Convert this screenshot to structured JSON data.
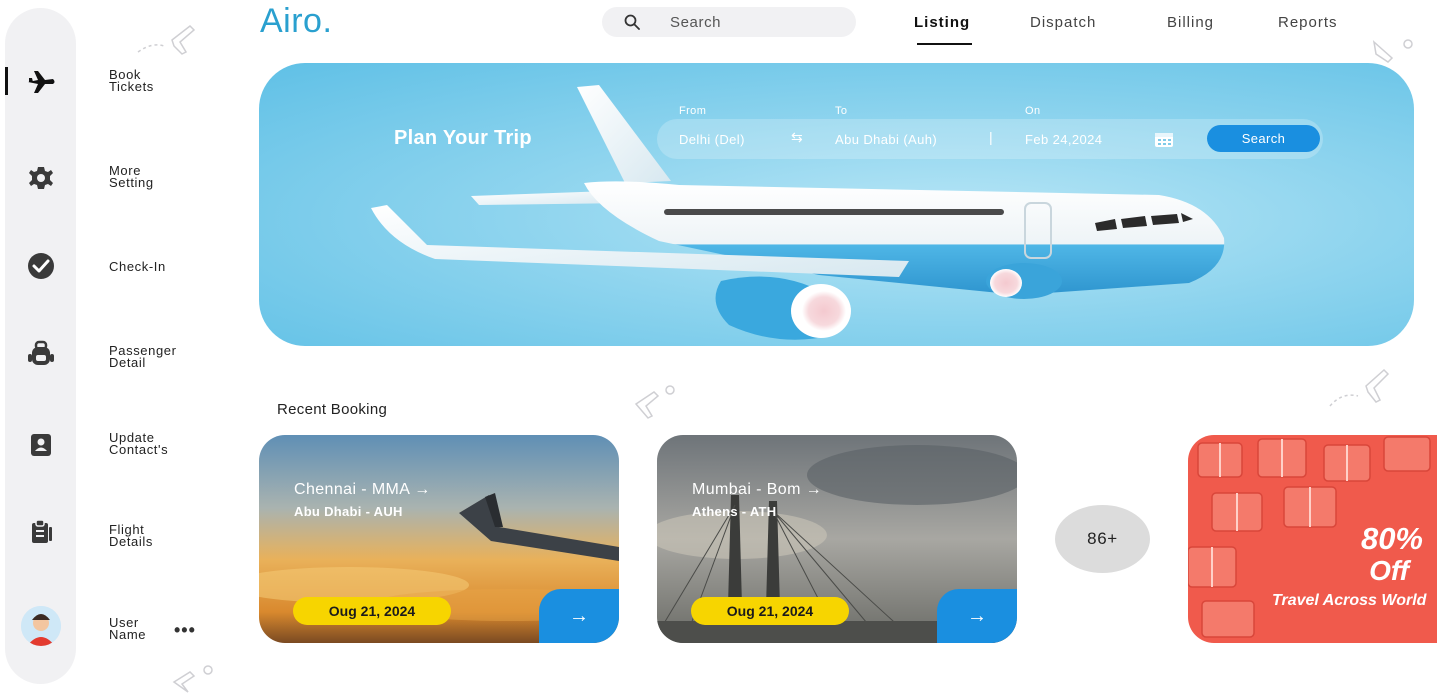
{
  "app": {
    "logo": "Airo."
  },
  "header": {
    "search_placeholder": "Search",
    "nav": [
      {
        "label": "Listing",
        "active": true
      },
      {
        "label": "Dispatch",
        "active": false
      },
      {
        "label": "Billing",
        "active": false
      },
      {
        "label": "Reports",
        "active": false
      }
    ]
  },
  "sidebar": {
    "items": [
      {
        "label_line1": "Book",
        "label_line2": "Tickets",
        "icon": "airplane-icon",
        "active": true
      },
      {
        "label_line1": "More",
        "label_line2": "Setting",
        "icon": "gear-icon",
        "active": false
      },
      {
        "label_line1": "Check-In",
        "label_line2": "",
        "icon": "check-circle-icon",
        "active": false
      },
      {
        "label_line1": "Passenger",
        "label_line2": "Detail",
        "icon": "backpack-icon",
        "active": false
      },
      {
        "label_line1": "Update",
        "label_line2": "Contact's",
        "icon": "contact-card-icon",
        "active": false
      },
      {
        "label_line1": "Flight",
        "label_line2": "Details",
        "icon": "clipboard-icon",
        "active": false
      }
    ],
    "user": {
      "line1": "User",
      "line2": "Name",
      "more": "•••"
    }
  },
  "hero": {
    "title": "Plan Your Trip",
    "from_label": "From",
    "from_value": "Delhi (Del)",
    "swap_symbol": "⇆",
    "to_label": "To",
    "to_value": "Abu Dhabi (Auh)",
    "separator": "|",
    "on_label": "On",
    "on_value": "Feb 24,2024",
    "search_button": "Search"
  },
  "recent": {
    "title": "Recent Booking",
    "bookings": [
      {
        "route": "Chennai - MMA →",
        "destination": "Abu Dhabi - AUH",
        "date": "Oug 21, 2024"
      },
      {
        "route": "Mumbai - Bom →",
        "destination": "Athens - ATH",
        "date": "Oug 21, 2024"
      }
    ],
    "more_count": "86+",
    "arrow": "→"
  },
  "promo": {
    "percent": "80%",
    "off": "Off",
    "tagline": "Travel Across World"
  },
  "colors": {
    "accent": "#1a8fe0",
    "logo": "#2aa0cf",
    "pill": "#f7d500",
    "promo": "#f05a4c"
  }
}
